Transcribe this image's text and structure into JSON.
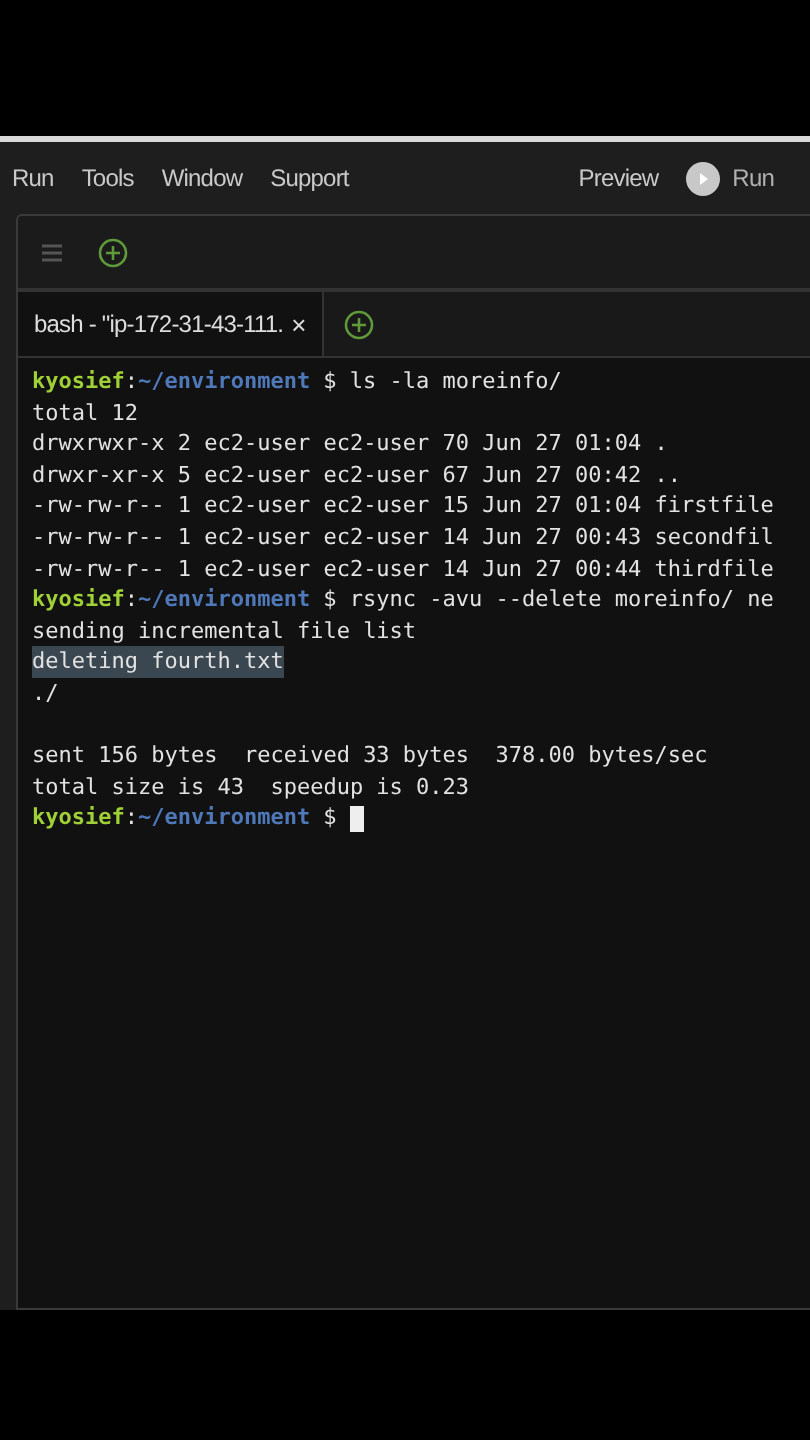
{
  "menu": {
    "items": [
      {
        "label": "Run"
      },
      {
        "label": "Tools"
      },
      {
        "label": "Window"
      },
      {
        "label": "Support"
      }
    ],
    "preview": "Preview",
    "run_button": "Run"
  },
  "terminal_tabs": [
    {
      "label": "bash - \"ip-172-31-43-111.",
      "close": "×",
      "selected": true
    }
  ],
  "terminal": {
    "lines": [
      {
        "kind": "prompt",
        "user": "kyosief",
        "separator": ":",
        "path": "~/environment",
        "symbol": "$",
        "command": "ls -la moreinfo/"
      },
      {
        "kind": "output",
        "text": "total 12",
        "selected": false
      },
      {
        "kind": "output",
        "text": "drwxrwxr-x 2 ec2-user ec2-user 70 Jun 27 01:04 .",
        "selected": false
      },
      {
        "kind": "output",
        "text": "drwxr-xr-x 5 ec2-user ec2-user 67 Jun 27 00:42 ..",
        "selected": false
      },
      {
        "kind": "output",
        "text": "-rw-rw-r-- 1 ec2-user ec2-user 15 Jun 27 01:04 firstfile",
        "selected": false
      },
      {
        "kind": "output",
        "text": "-rw-rw-r-- 1 ec2-user ec2-user 14 Jun 27 00:43 secondfil",
        "selected": false
      },
      {
        "kind": "output",
        "text": "-rw-rw-r-- 1 ec2-user ec2-user 14 Jun 27 00:44 thirdfile",
        "selected": false
      },
      {
        "kind": "prompt",
        "user": "kyosief",
        "separator": ":",
        "path": "~/environment",
        "symbol": "$",
        "command": "rsync -avu --delete moreinfo/ ne"
      },
      {
        "kind": "output",
        "text": "sending incremental file list",
        "selected": false
      },
      {
        "kind": "output",
        "text": "deleting fourth.txt",
        "selected": true
      },
      {
        "kind": "output",
        "text": "./",
        "selected": false
      },
      {
        "kind": "blank"
      },
      {
        "kind": "output",
        "text": "sent 156 bytes  received 33 bytes  378.00 bytes/sec",
        "selected": false
      },
      {
        "kind": "output",
        "text": "total size is 43  speedup is 0.23",
        "selected": false
      },
      {
        "kind": "prompt",
        "user": "kyosief",
        "separator": ":",
        "path": "~/environment",
        "symbol": "$",
        "cursor": true
      }
    ]
  }
}
